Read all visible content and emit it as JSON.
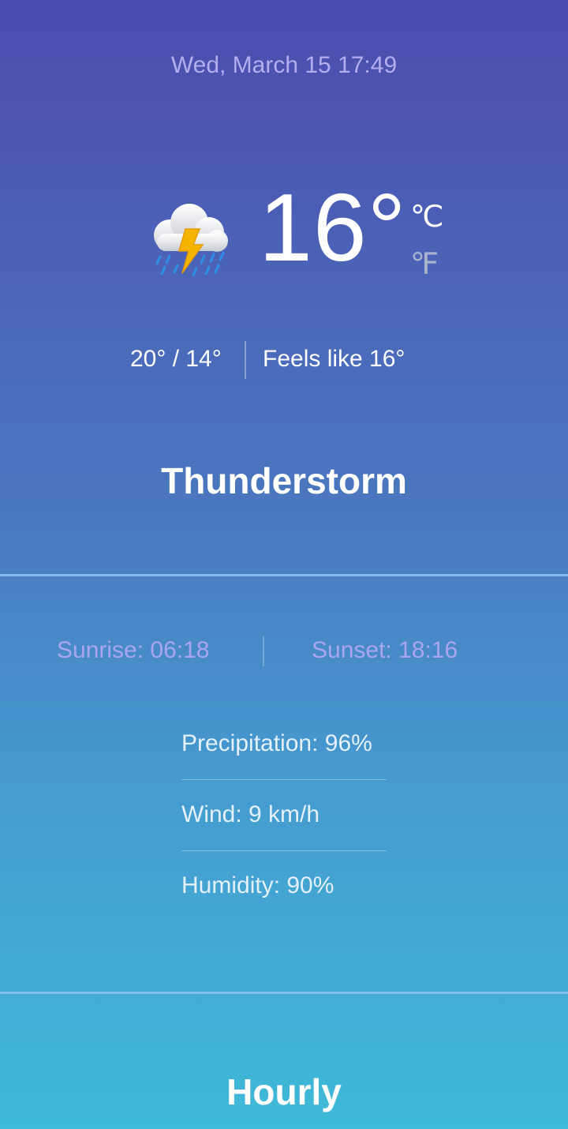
{
  "header": {
    "datetime": "Wed, March 15 17:49"
  },
  "current": {
    "icon": "thunderstorm-icon",
    "temperature": "16°",
    "unit_c": "℃",
    "unit_f": "℉",
    "selected_unit": "C",
    "high_low": "20° / 14°",
    "feels_like": "Feels like 16°",
    "condition": "Thunderstorm"
  },
  "sun": {
    "sunrise": "Sunrise: 06:18",
    "sunset": "Sunset: 18:16"
  },
  "details": {
    "precipitation": "Precipitation: 96%",
    "wind": "Wind: 9 km/h",
    "humidity": "Humidity: 90%"
  },
  "sections": {
    "hourly_title": "Hourly"
  },
  "colors": {
    "bg_top": "#4c4cae",
    "bg_bottom": "#3fbad8",
    "datetime_text": "#b4aef0",
    "sun_text": "#a9a6ef",
    "inactive_unit": "#a9b3cc",
    "bolt": "#f5b400"
  }
}
